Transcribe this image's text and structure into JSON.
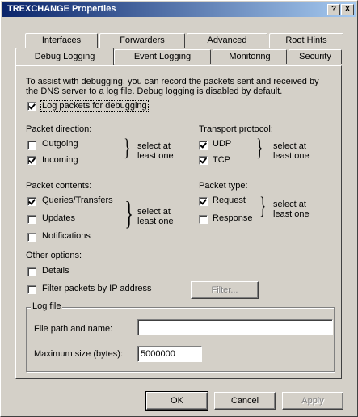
{
  "window": {
    "title": "TREXCHANGE Properties",
    "help_btn": "?",
    "close_btn": "X"
  },
  "tabs_back": [
    "Interfaces",
    "Forwarders",
    "Advanced",
    "Root Hints"
  ],
  "tabs_front": [
    "Debug Logging",
    "Event Logging",
    "Monitoring",
    "Security"
  ],
  "intro": {
    "line1": "To assist with debugging, you can record the packets sent and received by",
    "line2": "the DNS server to a log file. Debug logging is disabled by default."
  },
  "log_packets": {
    "label": "Log packets for debugging",
    "checked": true
  },
  "direction": {
    "heading": "Packet direction:",
    "outgoing": "Outgoing",
    "incoming": "Incoming",
    "note1": "select at",
    "note2": "least one"
  },
  "transport": {
    "heading": "Transport protocol:",
    "udp": "UDP",
    "tcp": "TCP",
    "note1": "select at",
    "note2": "least one"
  },
  "contents": {
    "heading": "Packet contents:",
    "queries": "Queries/Transfers",
    "updates": "Updates",
    "notifications": "Notifications",
    "note1": "select at",
    "note2": "least one"
  },
  "ptype": {
    "heading": "Packet type:",
    "request": "Request",
    "response": "Response",
    "note1": "select at",
    "note2": "least one"
  },
  "other": {
    "heading": "Other options:",
    "details": "Details",
    "filter_ip": "Filter packets by IP address",
    "filter_btn": "Filter..."
  },
  "logfile": {
    "heading": "Log file",
    "path_label": "File path and name:",
    "path_value": "",
    "size_label": "Maximum size (bytes):",
    "size_value": "5000000"
  },
  "buttons": {
    "ok": "OK",
    "cancel": "Cancel",
    "apply": "Apply"
  }
}
